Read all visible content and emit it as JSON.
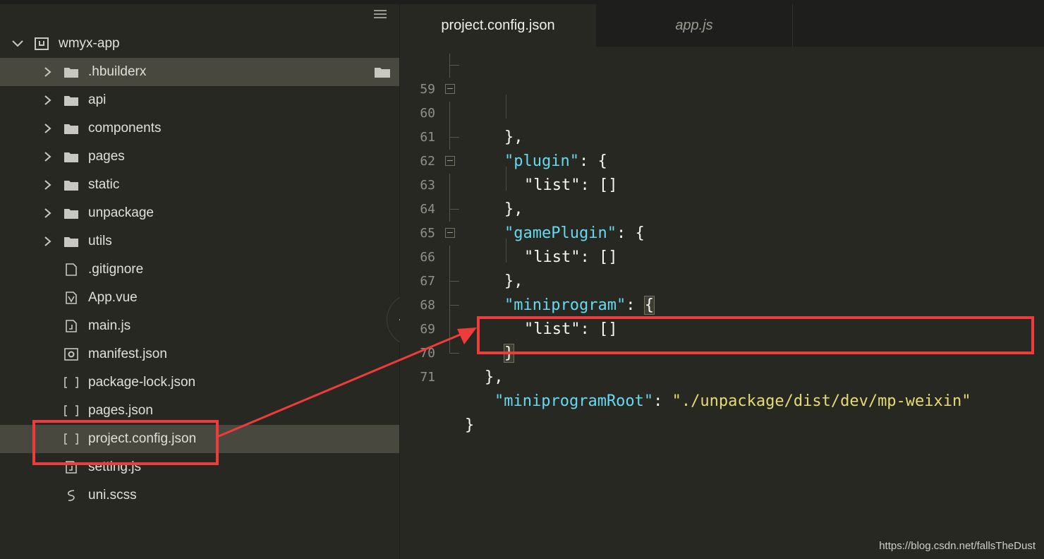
{
  "sidebar": {
    "root": "wmyx-app",
    "items": [
      {
        "label": ".hbuilderx",
        "type": "folder",
        "selected": true
      },
      {
        "label": "api",
        "type": "folder"
      },
      {
        "label": "components",
        "type": "folder"
      },
      {
        "label": "pages",
        "type": "folder"
      },
      {
        "label": "static",
        "type": "folder"
      },
      {
        "label": "unpackage",
        "type": "folder"
      },
      {
        "label": "utils",
        "type": "folder"
      },
      {
        "label": ".gitignore",
        "type": "file"
      },
      {
        "label": "App.vue",
        "type": "vue"
      },
      {
        "label": "main.js",
        "type": "js"
      },
      {
        "label": "manifest.json",
        "type": "manifest"
      },
      {
        "label": "package-lock.json",
        "type": "json"
      },
      {
        "label": "pages.json",
        "type": "json"
      },
      {
        "label": "project.config.json",
        "type": "json",
        "active": true
      },
      {
        "label": "setting.js",
        "type": "js"
      },
      {
        "label": "uni.scss",
        "type": "scss"
      }
    ]
  },
  "tabs": [
    {
      "label": "project.config.json",
      "active": true
    },
    {
      "label": "app.js",
      "active": false
    }
  ],
  "editor": {
    "lines": [
      "59",
      "60",
      "61",
      "62",
      "63",
      "64",
      "65",
      "66",
      "67",
      "68",
      "69",
      "70",
      "71"
    ],
    "code": {
      "l59": "},",
      "l60_key": "\"plugin\"",
      "l60_rest": ": {",
      "l61_key": "\"list\"",
      "l61_rest": ": []",
      "l62": "},",
      "l63_key": "\"gamePlugin\"",
      "l63_rest": ": {",
      "l64_key": "\"list\"",
      "l64_rest": ": []",
      "l65": "},",
      "l66_key": "\"miniprogram\"",
      "l66_rest": ": ",
      "l66_brace": "{",
      "l67_key": "\"list\"",
      "l67_rest": ": []",
      "l68": "}",
      "l69": "},",
      "l70_key": "\"miniprogramRoot\"",
      "l70_colon": ": ",
      "l70_value": "\"./unpackage/dist/dev/mp-weixin\"",
      "l71": "}"
    }
  },
  "watermark": "https://blog.csdn.net/fallsTheDust",
  "colors": {
    "annotation": "#ee3b3b",
    "key": "#66d9ef",
    "string": "#e6db74"
  }
}
